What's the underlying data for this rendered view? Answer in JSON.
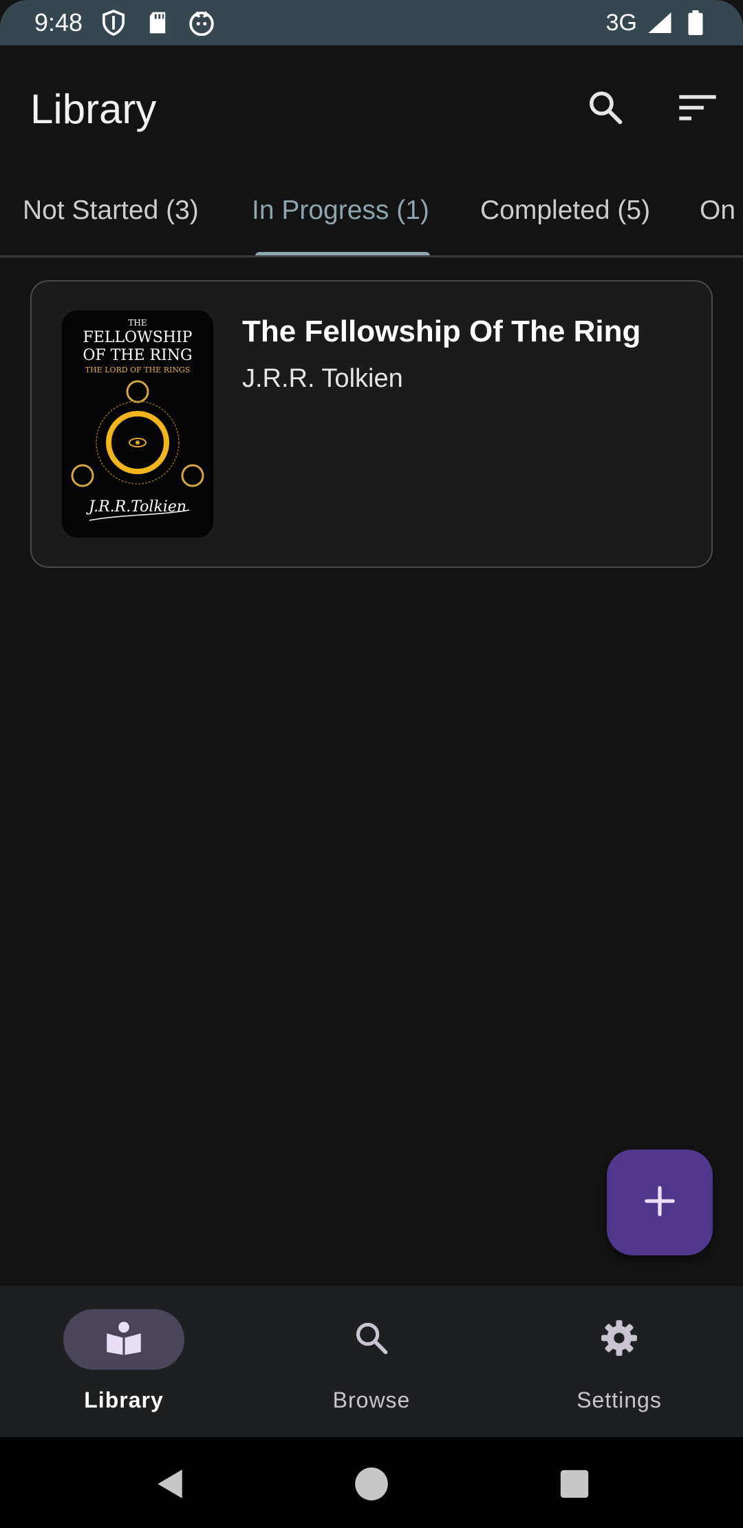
{
  "status_bar": {
    "time": "9:48",
    "network_type": "3G",
    "icons": [
      "shield-icon",
      "sd-card-icon",
      "cat-icon",
      "signal-icon",
      "battery-icon"
    ]
  },
  "app_bar": {
    "title": "Library",
    "actions": [
      "search-icon",
      "sort-icon"
    ]
  },
  "tabs": [
    {
      "label": "Not Started (3)",
      "active": false
    },
    {
      "label": "In Progress (1)",
      "active": true
    },
    {
      "label": "Completed (5)",
      "active": false
    },
    {
      "label": "On Hold",
      "active": false
    }
  ],
  "books": [
    {
      "title": "The Fellowship Of The Ring",
      "author": "J.R.R. Tolkien",
      "cover": {
        "line1": "THE",
        "line2": "FELLOWSHIP",
        "line3": "OF THE RING",
        "line4": "THE LORD OF THE RINGS",
        "signature": "J.R.R.Tolkien"
      }
    }
  ],
  "fab": {
    "icon": "plus-icon"
  },
  "bottom_nav": [
    {
      "label": "Library",
      "icon": "book-reader-icon",
      "active": true
    },
    {
      "label": "Browse",
      "icon": "search-icon",
      "active": false
    },
    {
      "label": "Settings",
      "icon": "gear-icon",
      "active": false
    }
  ],
  "system_nav": [
    "back-icon",
    "home-icon",
    "recents-icon"
  ],
  "colors": {
    "accent": "#90a4ae",
    "fab": "#4f378b",
    "background": "#131313",
    "status_bar": "#37474f",
    "nav_active_pill": "#4a4458"
  }
}
